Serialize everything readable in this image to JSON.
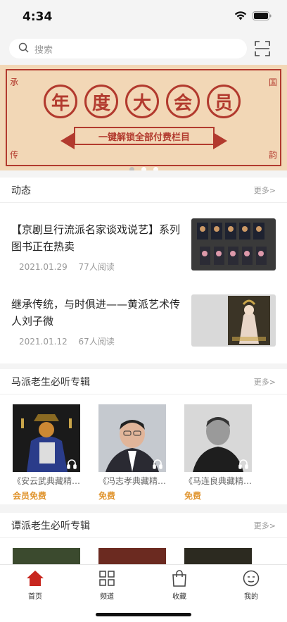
{
  "status": {
    "time": "4:34"
  },
  "search": {
    "placeholder": "搜索"
  },
  "banner": {
    "title_chars": [
      "年",
      "度",
      "大",
      "会",
      "员"
    ],
    "subtitle": "一键解锁全部付费栏目",
    "corners": [
      "承",
      "国",
      "传",
      "韵"
    ],
    "page_count": 3,
    "active_page": 0
  },
  "news": {
    "title": "动态",
    "more": "更多>",
    "items": [
      {
        "title": "【京剧旦行流派名家谈戏说艺】系列图书正在热卖",
        "date": "2021.01.29",
        "reads": "77人阅读"
      },
      {
        "title": "继承传统，与时俱进——黄派艺术传人刘子微",
        "date": "2021.01.12",
        "reads": "67人阅读"
      }
    ]
  },
  "ma_section": {
    "title": "马派老生必听专辑",
    "more": "更多>",
    "albums": [
      {
        "name": "《安云武典藏精…",
        "price": "会员免费"
      },
      {
        "name": "《冯志孝典藏精…",
        "price": "免费"
      },
      {
        "name": "《马连良典藏精…",
        "price": "免费"
      }
    ]
  },
  "tan_section": {
    "title": "谭派老生必听专辑",
    "more": "更多>"
  },
  "tabs": [
    {
      "label": "首页",
      "icon": "home-icon",
      "active": true
    },
    {
      "label": "频道",
      "icon": "grid-icon",
      "active": false
    },
    {
      "label": "收藏",
      "icon": "bag-icon",
      "active": false
    },
    {
      "label": "我的",
      "icon": "profile-icon",
      "active": false
    }
  ],
  "colors": {
    "accent": "#c8271f",
    "price": "#e0942e",
    "banner_red": "#b23a2e",
    "banner_bg": "#f2d7b6"
  }
}
